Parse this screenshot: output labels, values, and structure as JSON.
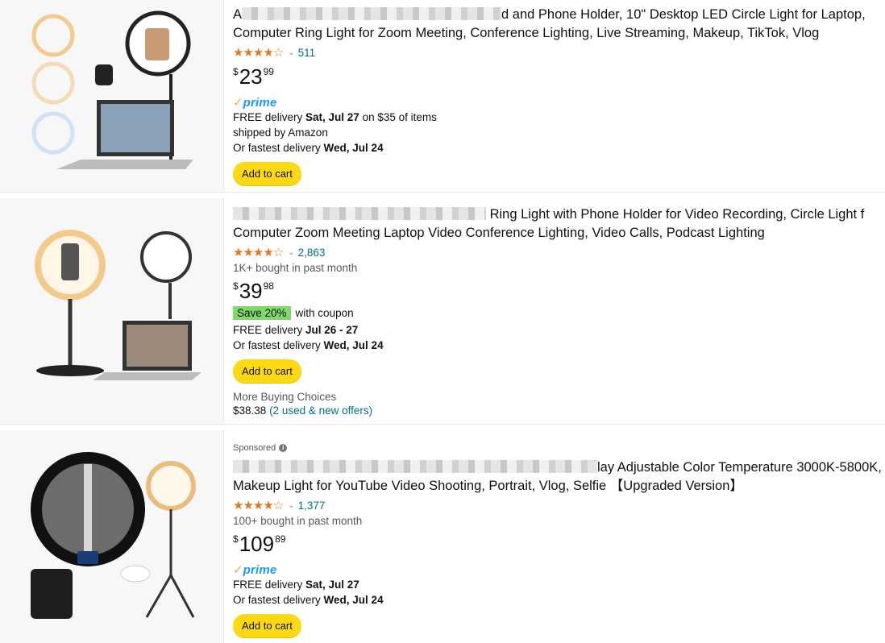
{
  "products": [
    {
      "title_line1_prefix": "A",
      "title_line1_rest": "d and Phone Holder, 10\" Desktop LED Circle Light for Laptop,",
      "title_line2": "Computer Ring Light for Zoom Meeting, Conference Lighting, Live Streaming, Makeup, TikTok, Vlog",
      "rating_stars": "★★★★☆",
      "review_count": "511",
      "price_symbol": "$",
      "price_whole": "23",
      "price_fraction": "99",
      "prime_label": "prime",
      "delivery_prefix": "FREE delivery ",
      "delivery_date": "Sat, Jul 27",
      "delivery_suffix": " on $35 of items",
      "shipped_by": "shipped by Amazon",
      "fastest_prefix": "Or fastest delivery ",
      "fastest_date": "Wed, Jul 24",
      "add_to_cart": "Add to cart"
    },
    {
      "title_line1_rest": "Ring Light with Phone Holder for Video Recording, Circle Light f",
      "title_line2": "Computer Zoom Meeting Laptop Video Conference Lighting, Video Calls, Podcast Lighting",
      "rating_stars": "★★★★☆",
      "review_count": "2,863",
      "bought": "1K+ bought in past month",
      "price_symbol": "$",
      "price_whole": "39",
      "price_fraction": "98",
      "coupon_badge": "Save 20%",
      "coupon_text": "with coupon",
      "delivery_prefix": "FREE delivery ",
      "delivery_date": "Jul 26 - 27",
      "fastest_prefix": "Or fastest delivery ",
      "fastest_date": "Wed, Jul 24",
      "add_to_cart": "Add to cart",
      "more_choices": "More Buying Choices",
      "offer_price": "$38.38",
      "offers_link": "(2 used & new offers)"
    },
    {
      "sponsored": "Sponsored",
      "title_line1_rest": "lay Adjustable Color Temperature 3000K-5800K,",
      "title_line2": "Makeup Light for YouTube Video Shooting, Portrait, Vlog, Selfie 【Upgraded Version】",
      "rating_stars": "★★★★☆",
      "review_count": "1,377",
      "bought": "100+ bought in past month",
      "price_symbol": "$",
      "price_whole": "109",
      "price_fraction": "89",
      "prime_label": "prime",
      "delivery_prefix": "FREE delivery ",
      "delivery_date": "Sat, Jul 27",
      "fastest_prefix": "Or fastest delivery ",
      "fastest_date": "Wed, Jul 24",
      "add_to_cart": "Add to cart"
    }
  ],
  "colors": {
    "star": "#de7921",
    "link": "#007185",
    "cart_button": "#ffd814",
    "prime_blue": "#1a98ff",
    "coupon_green": "#7fda69"
  }
}
